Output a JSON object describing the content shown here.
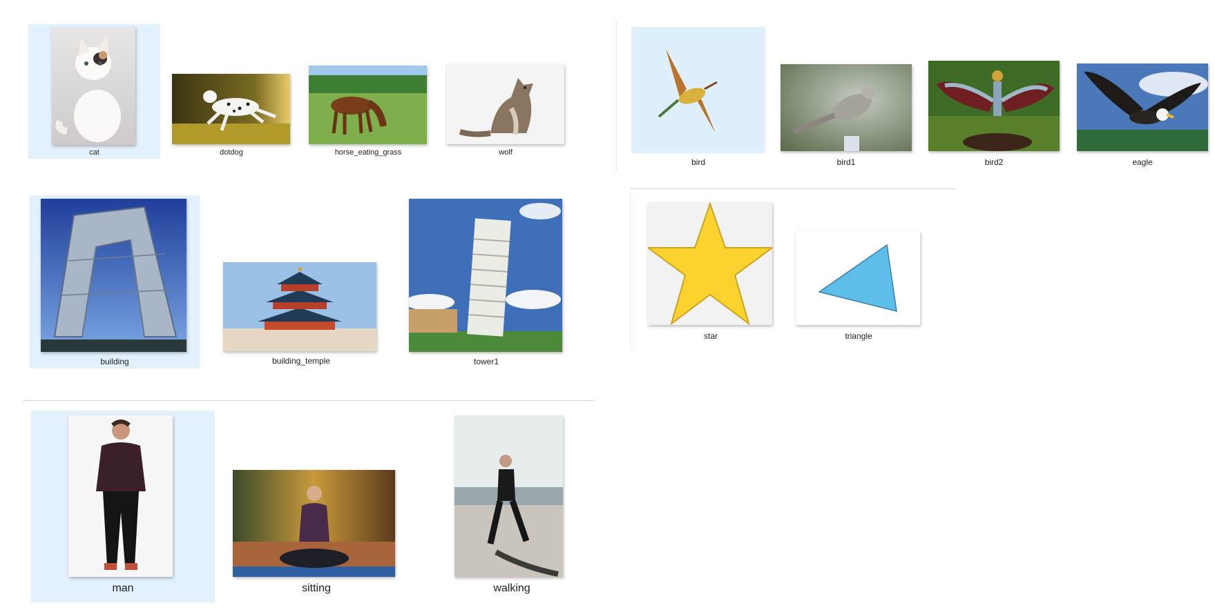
{
  "groups": {
    "animals": {
      "items": [
        {
          "name": "cat",
          "selected": true
        },
        {
          "name": "dotdog",
          "selected": false
        },
        {
          "name": "horse_eating_grass",
          "selected": false
        },
        {
          "name": "wolf",
          "selected": false
        }
      ]
    },
    "birds": {
      "items": [
        {
          "name": "bird",
          "selected": true
        },
        {
          "name": "bird1",
          "selected": false
        },
        {
          "name": "bird2",
          "selected": false
        },
        {
          "name": "eagle",
          "selected": false
        }
      ]
    },
    "buildings": {
      "items": [
        {
          "name": "building",
          "selected": true
        },
        {
          "name": "building_temple",
          "selected": false
        },
        {
          "name": "tower1",
          "selected": false
        }
      ]
    },
    "shapes": {
      "items": [
        {
          "name": "star",
          "selected": false
        },
        {
          "name": "triangle",
          "selected": false
        }
      ]
    },
    "people": {
      "items": [
        {
          "name": "man",
          "selected": true
        },
        {
          "name": "sitting",
          "selected": false
        },
        {
          "name": "walking",
          "selected": false
        }
      ]
    }
  },
  "colors": {
    "selection": "#e3f0fd",
    "star_fill": "#fcd22e",
    "triangle_fill": "#5fbdea"
  }
}
